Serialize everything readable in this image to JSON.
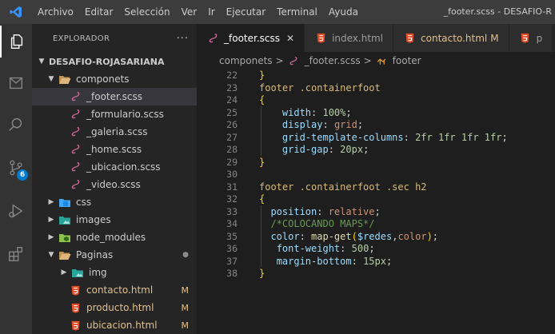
{
  "titlebar": {
    "menu": [
      "Archivo",
      "Editar",
      "Selección",
      "Ver",
      "Ir",
      "Ejecutar",
      "Terminal",
      "Ayuda"
    ],
    "window_title": "_footer.scss - DESAFIO-R"
  },
  "activity": {
    "scm_badge": "6"
  },
  "sidebar": {
    "header": "EXPLORADOR",
    "more": "···",
    "root": "DESAFIO-ROJASARIANA",
    "items": [
      {
        "label": "componets",
        "type": "folder-open",
        "depth": 1,
        "mod": ""
      },
      {
        "label": "_footer.scss",
        "type": "scss",
        "depth": 2,
        "mod": "",
        "selected": true
      },
      {
        "label": "_formulario.scss",
        "type": "scss",
        "depth": 2,
        "mod": ""
      },
      {
        "label": "_galeria.scss",
        "type": "scss",
        "depth": 2,
        "mod": ""
      },
      {
        "label": "_home.scss",
        "type": "scss",
        "depth": 2,
        "mod": ""
      },
      {
        "label": "_ubicacion.scss",
        "type": "scss",
        "depth": 2,
        "mod": ""
      },
      {
        "label": "_video.scss",
        "type": "scss",
        "depth": 2,
        "mod": ""
      },
      {
        "label": "css",
        "type": "folder-css",
        "depth": 1,
        "mod": ""
      },
      {
        "label": "images",
        "type": "folder-images",
        "depth": 1,
        "mod": ""
      },
      {
        "label": "node_modules",
        "type": "folder-node",
        "depth": 1,
        "mod": ""
      },
      {
        "label": "Paginas",
        "type": "folder-open",
        "depth": 1,
        "mod": "●"
      },
      {
        "label": "img",
        "type": "folder-images",
        "depth": 2,
        "mod": ""
      },
      {
        "label": "contacto.html",
        "type": "html",
        "depth": 2,
        "mod": "M"
      },
      {
        "label": "producto.html",
        "type": "html",
        "depth": 2,
        "mod": "M"
      },
      {
        "label": "ubicacion.html",
        "type": "html",
        "depth": 2,
        "mod": "M"
      }
    ]
  },
  "tabs": [
    {
      "label": "_footer.scss",
      "type": "scss",
      "active": true,
      "close": "✕",
      "mod": ""
    },
    {
      "label": "index.html",
      "type": "html",
      "active": false,
      "close": "",
      "mod": ""
    },
    {
      "label": "contacto.html",
      "type": "html",
      "active": false,
      "close": "",
      "mod": "M"
    },
    {
      "label": "p",
      "type": "html",
      "active": false,
      "close": "",
      "mod": ""
    }
  ],
  "breadcrumb": {
    "folder": "componets",
    "sep": ">",
    "file": "_footer.scss",
    "symbol": "footer"
  },
  "editor": {
    "lines": [
      {
        "n": "22",
        "tokens": [
          [
            "}",
            "br y"
          ]
        ]
      },
      {
        "n": "23",
        "tokens": [
          [
            "footer .containerfoot",
            "sel"
          ]
        ]
      },
      {
        "n": "24",
        "tokens": [
          [
            "{",
            "br y"
          ]
        ]
      },
      {
        "n": "25",
        "tokens": [
          [
            "    ",
            ""
          ],
          [
            "width",
            "prop"
          ],
          [
            ": ",
            ""
          ],
          [
            "100%",
            "num"
          ],
          [
            ";",
            ""
          ]
        ]
      },
      {
        "n": "26",
        "tokens": [
          [
            "    ",
            ""
          ],
          [
            "display",
            "prop"
          ],
          [
            ": ",
            ""
          ],
          [
            "grid",
            "val"
          ],
          [
            ";",
            ""
          ]
        ]
      },
      {
        "n": "27",
        "tokens": [
          [
            "    ",
            ""
          ],
          [
            "grid-template-columns",
            "prop"
          ],
          [
            ": ",
            ""
          ],
          [
            "2fr 1fr 1fr 1fr",
            "num"
          ],
          [
            ";",
            ""
          ]
        ]
      },
      {
        "n": "28",
        "tokens": [
          [
            "    ",
            ""
          ],
          [
            "grid-gap",
            "prop"
          ],
          [
            ": ",
            ""
          ],
          [
            "20px",
            "num"
          ],
          [
            ";",
            ""
          ]
        ]
      },
      {
        "n": "29",
        "tokens": [
          [
            "}",
            "br y"
          ]
        ]
      },
      {
        "n": "30",
        "tokens": []
      },
      {
        "n": "31",
        "tokens": [
          [
            "footer .containerfoot .sec h2",
            "sel"
          ]
        ]
      },
      {
        "n": "32",
        "tokens": [
          [
            "{",
            "br y"
          ]
        ]
      },
      {
        "n": "33",
        "tokens": [
          [
            "  ",
            ""
          ],
          [
            "position",
            "prop"
          ],
          [
            ": ",
            ""
          ],
          [
            "relative",
            "val"
          ],
          [
            ";",
            ""
          ]
        ]
      },
      {
        "n": "34",
        "tokens": [
          [
            "  ",
            ""
          ],
          [
            "/*COLOCANDO MAPS*/",
            "cmt"
          ]
        ]
      },
      {
        "n": "35",
        "tokens": [
          [
            "  ",
            ""
          ],
          [
            "color",
            "prop"
          ],
          [
            ": ",
            ""
          ],
          [
            "map-get",
            "fn"
          ],
          [
            "(",
            "br y"
          ],
          [
            "$redes",
            "prop"
          ],
          [
            ",",
            ""
          ],
          [
            "color",
            "val"
          ],
          [
            ")",
            "br y"
          ],
          [
            ";",
            ""
          ]
        ]
      },
      {
        "n": "36",
        "tokens": [
          [
            "   ",
            ""
          ],
          [
            "font-weight",
            "prop"
          ],
          [
            ": ",
            ""
          ],
          [
            "500",
            "num"
          ],
          [
            ";",
            ""
          ]
        ]
      },
      {
        "n": "37",
        "tokens": [
          [
            "   ",
            ""
          ],
          [
            "margin-bottom",
            "prop"
          ],
          [
            ": ",
            ""
          ],
          [
            "15px",
            "num"
          ],
          [
            ";",
            ""
          ]
        ]
      },
      {
        "n": "38",
        "tokens": [
          [
            "}",
            "br y"
          ]
        ]
      }
    ]
  },
  "colors": {
    "accent": "#007acc",
    "scss_icon": "#cd6799",
    "html_icon": "#e44d26",
    "modified": "#e2c08d"
  }
}
